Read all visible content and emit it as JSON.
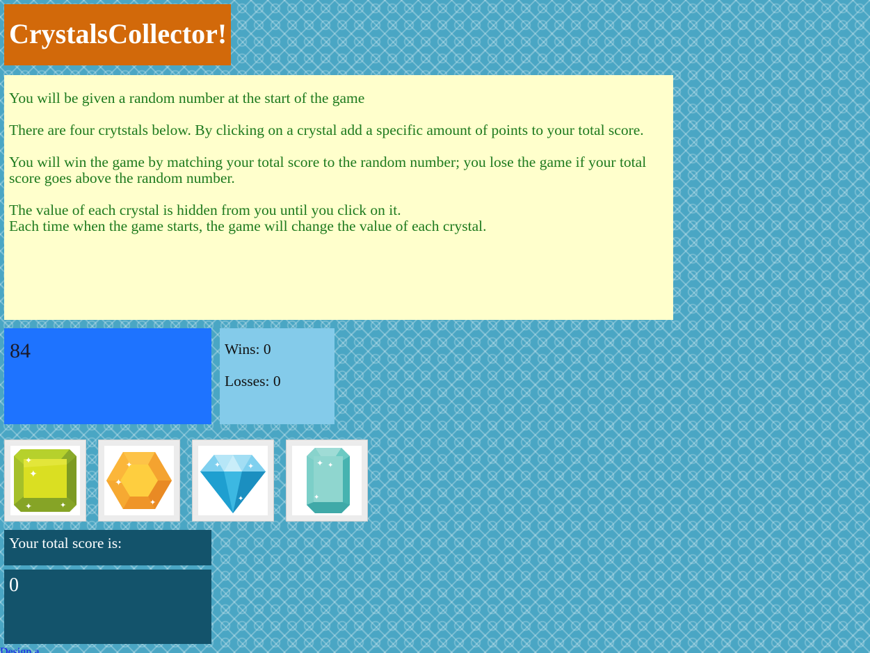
{
  "header": {
    "title": "CrystalsCollector!"
  },
  "instructions": {
    "line1": "You will be given a random number at the start of the game",
    "line2": "There are four crytstals below. By clicking on a crystal add a specific amount of points to your total score.",
    "line3": "You will win the game by matching your total score to the random number; you lose the game if your total score goes above the random number.",
    "line4a": "The value of each crystal is hidden from you until you click on it.",
    "line4b": "Each time when the game starts, the game will change the value of each crystal."
  },
  "target": {
    "number": "84"
  },
  "stats": {
    "wins": "Wins: 0",
    "losses": "Losses: 0"
  },
  "crystals": [
    {
      "icon": "green-square-gem-icon",
      "color": "#c4d62a"
    },
    {
      "icon": "orange-hexagon-gem-icon",
      "color": "#fbb73c"
    },
    {
      "icon": "blue-diamond-gem-icon",
      "color": "#2fb0dd"
    },
    {
      "icon": "teal-emerald-gem-icon",
      "color": "#72cfc6"
    }
  ],
  "score": {
    "label": "Your total score is:",
    "value": "0"
  },
  "footer": {
    "link_text": "Design a"
  },
  "colors": {
    "title_bg": "#d2690a",
    "instructions_bg": "#ffffcc",
    "instructions_text": "#1e7a1e",
    "target_bg": "#1e73ff",
    "stats_bg": "#84cbea",
    "score_bg": "#13536b",
    "page_bg": "#4aa6c4"
  }
}
